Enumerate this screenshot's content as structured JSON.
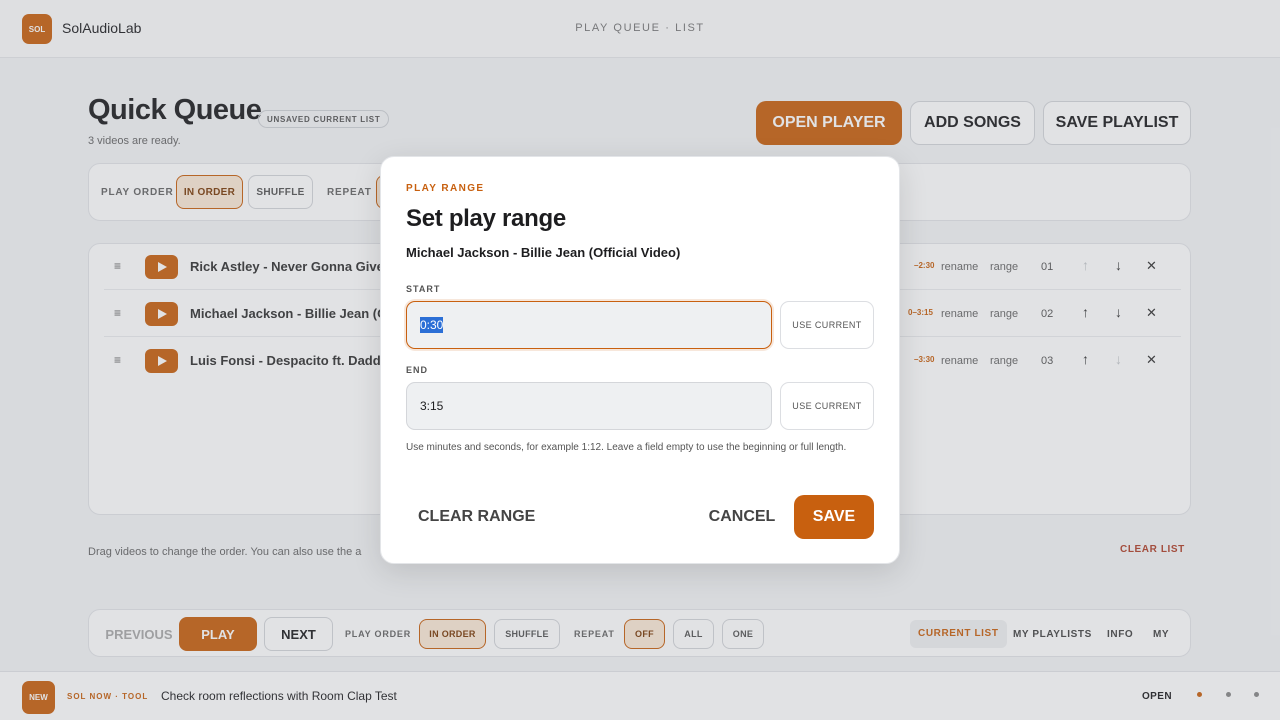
{
  "brand": {
    "logo": "SOL",
    "name": "SolAudioLab"
  },
  "page_mode": "PLAY QUEUE · LIST",
  "header": {
    "title": "Quick Queue",
    "badge": "UNSAVED CURRENT LIST",
    "subtitle": "3 videos are ready.",
    "open_player": "OPEN PLAYER",
    "add_songs": "ADD SONGS",
    "save_playlist": "SAVE PLAYLIST"
  },
  "order_bar": {
    "play_order_label": "PLAY ORDER",
    "in_order": "IN ORDER",
    "shuffle": "SHUFFLE",
    "repeat_label": "REPEAT"
  },
  "queue": [
    {
      "title": "Rick Astley - Never Gonna Give",
      "time": "–2:30",
      "rename": "rename",
      "range": "range",
      "num": "01"
    },
    {
      "title": "Michael Jackson - Billie Jean (O",
      "time": "0–3:15",
      "rename": "rename",
      "range": "range",
      "num": "02"
    },
    {
      "title": "Luis Fonsi - Despacito ft. Daddy",
      "time": "–3:30",
      "rename": "rename",
      "range": "range",
      "num": "03"
    }
  ],
  "hint": "Drag videos to change the order. You can also use the a",
  "clear_list": "CLEAR LIST",
  "player": {
    "previous": "PREVIOUS",
    "play": "PLAY",
    "next": "NEXT",
    "play_order_label": "PLAY ORDER",
    "in_order": "IN ORDER",
    "shuffle": "SHUFFLE",
    "repeat_label": "REPEAT",
    "off": "OFF",
    "all": "ALL",
    "one": "ONE",
    "tabs": [
      "CURRENT LIST",
      "MY PLAYLISTS",
      "INFO",
      "MY"
    ]
  },
  "news": {
    "badge": "NEW",
    "kicker": "SOL NOW · TOOL",
    "text": "Check room reflections with Room Clap Test",
    "open": "OPEN"
  },
  "modal": {
    "kicker": "PLAY RANGE",
    "title": "Set play range",
    "song": "Michael Jackson - Billie Jean (Official Video)",
    "start_label": "START",
    "start_value": "0:30",
    "end_label": "END",
    "end_value": "3:15",
    "use_current": "USE CURRENT",
    "help": "Use minutes and seconds, for example 1:12. Leave a field empty to use the beginning or full length.",
    "clear_range": "CLEAR RANGE",
    "cancel": "CANCEL",
    "save": "SAVE"
  },
  "colors": {
    "accent": "#c8600f",
    "danger": "#b0412a",
    "background": "#f4f5f7"
  },
  "icons": {
    "drag": "drag-handle-icon",
    "video": "play-triangle-icon",
    "up": "arrow-up-icon",
    "down": "arrow-down-icon",
    "remove": "close-icon"
  }
}
